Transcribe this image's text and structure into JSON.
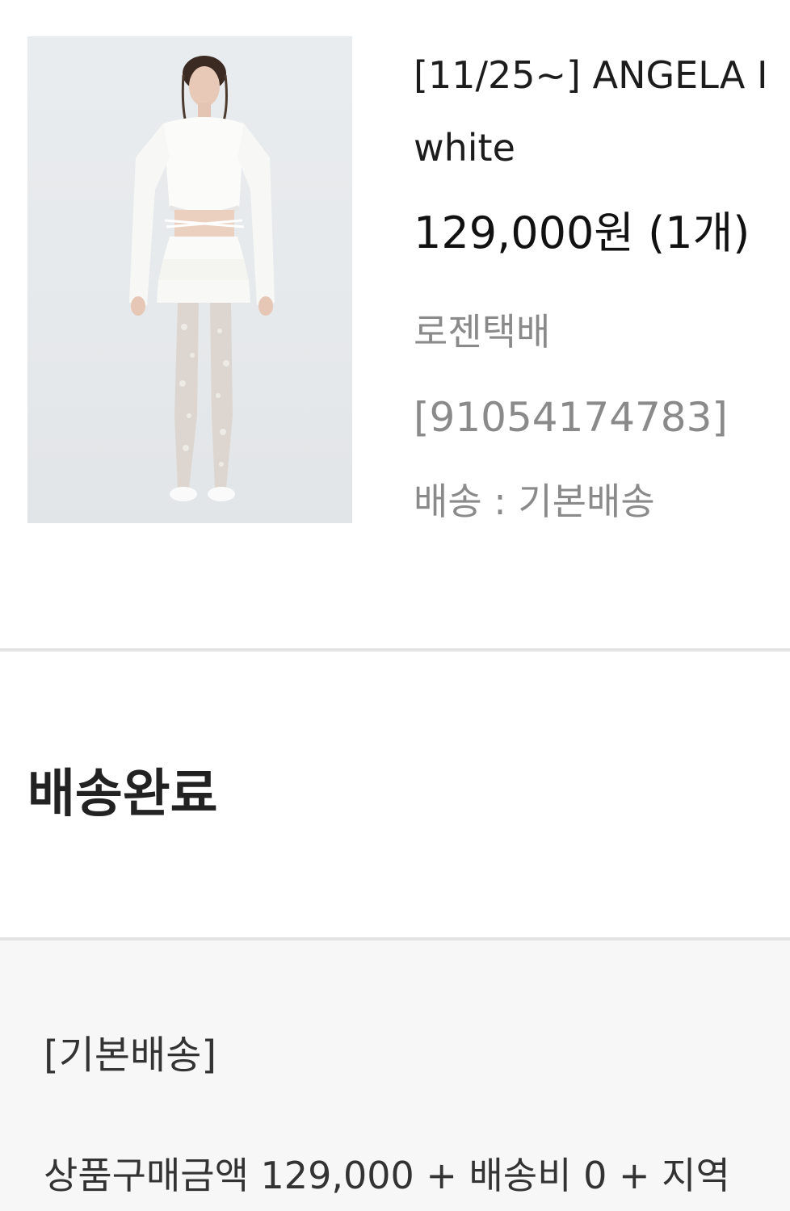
{
  "product": {
    "name": "[11/25~] ANGELA I",
    "option": "white",
    "price": "129,000원 (1개)",
    "carrier": "로젠택배",
    "tracking": "[91054174783]",
    "shipping_method": "배송 : 기본배송"
  },
  "status": {
    "label": "배송완료"
  },
  "summary": {
    "title": "[기본배송]",
    "line": "상품구매금액 129,000 + 배송비 0 + 지역"
  }
}
